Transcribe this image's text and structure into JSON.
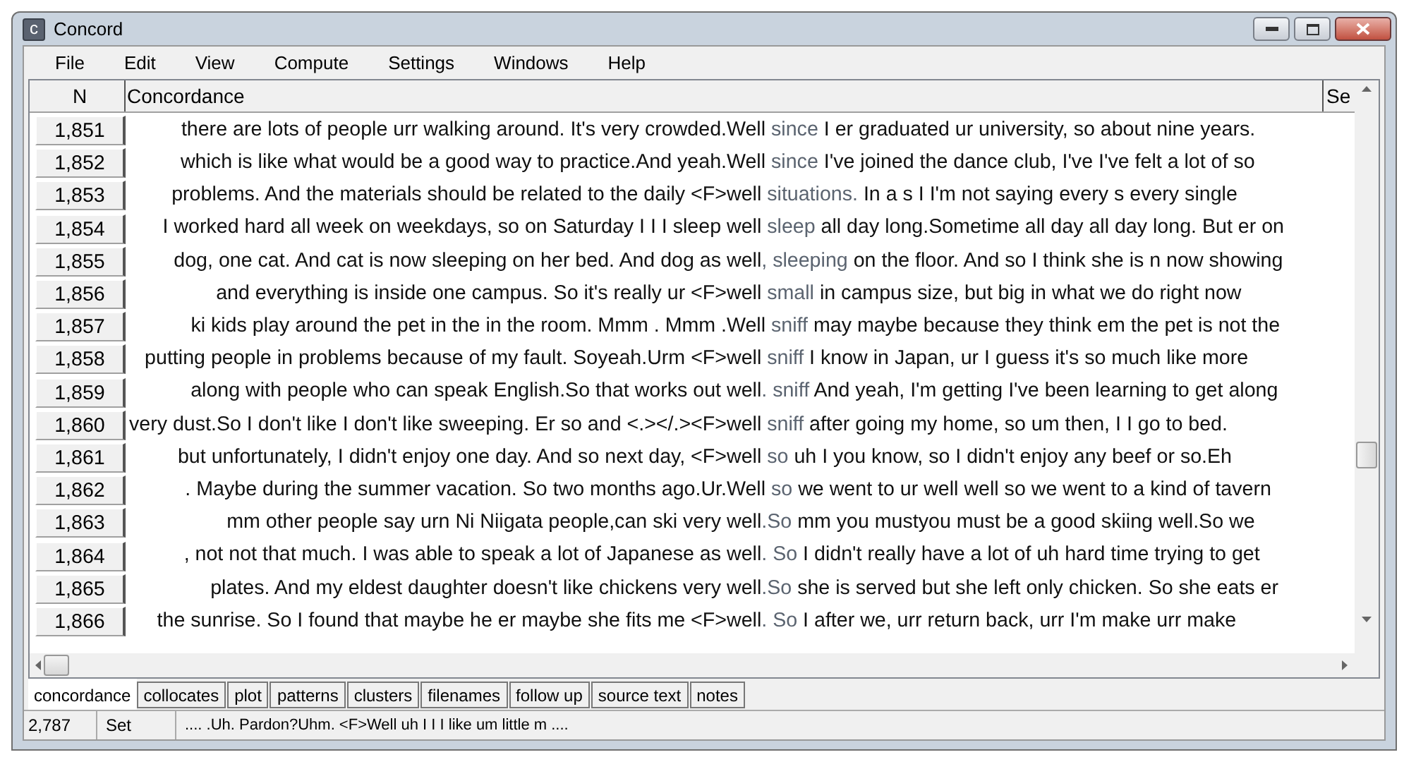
{
  "window": {
    "title": "Concord",
    "icon_letter": "c"
  },
  "menu": [
    "File",
    "Edit",
    "View",
    "Compute",
    "Settings",
    "Windows",
    "Help"
  ],
  "table": {
    "columns": [
      "N",
      "Concordance",
      "Se"
    ],
    "rows": [
      {
        "n": "1,851",
        "left": "there are lots of people urr walking around. It's very crowded.",
        "node": "Well",
        "collocate": " since",
        "right": " I er graduated ur university, so about nine years."
      },
      {
        "n": "1,852",
        "left": "which is like what would be a good way to practice.And yeah.",
        "node": "Well",
        "collocate": " since",
        "right": " I've joined the dance club, I've I've felt a lot of so"
      },
      {
        "n": "1,853",
        "left": "problems. And the materials should be related to the daily <F>",
        "node": "well",
        "collocate": " situations.",
        "right": " In a s I I'm not saying every s every single"
      },
      {
        "n": "1,854",
        "left": "I worked hard all week on weekdays, so on Saturday I I I sleep ",
        "node": "well",
        "collocate": " sleep",
        "right": " all day long.Sometime all day all day long. But er on"
      },
      {
        "n": "1,855",
        "left": "dog, one cat. And cat is now sleeping on her bed. And dog as ",
        "node": "well",
        "collocate": ", sleeping",
        "right": " on the floor. And so I think she is n now showing"
      },
      {
        "n": "1,856",
        "left": "and everything is inside one campus. So it's really ur <F>",
        "node": "well",
        "collocate": " small",
        "right": " in campus size, but big in what we do right now"
      },
      {
        "n": "1,857",
        "left": "ki kids play around the pet in the in the room. Mmm . Mmm .",
        "node": "Well",
        "collocate": " sniff",
        "right": " may maybe because they think em the pet is not the"
      },
      {
        "n": "1,858",
        "left": "putting people in problems because of my fault. Soyeah.Urm <F>",
        "node": "well",
        "collocate": " sniff",
        "right": " I know in Japan, ur I guess it's so much like more"
      },
      {
        "n": "1,859",
        "left": "along with people who can speak English.So that works out ",
        "node": "well",
        "collocate": ". sniff",
        "right": " And yeah, I'm getting I've been learning to get along"
      },
      {
        "n": "1,860",
        "left": "very dust.So I don't like I don't like sweeping. Er so and <.></.><F>",
        "node": "well",
        "collocate": " sniff",
        "right": " after going my home, so um then, I I go to bed."
      },
      {
        "n": "1,861",
        "left": "but unfortunately, I didn't enjoy one day. And so next day, <F>",
        "node": "well",
        "collocate": " so",
        "right": " uh I you know, so I didn't enjoy any beef or so.Eh"
      },
      {
        "n": "1,862",
        "left": ". Maybe during the summer vacation. So two months ago.Ur.",
        "node": "Well",
        "collocate": " so",
        "right": " we went to ur well well so we went to a kind of tavern"
      },
      {
        "n": "1,863",
        "left": "mm other people say urn Ni Niigata people,can ski very ",
        "node": "well",
        "collocate": ".So",
        "right": " mm you mustyou must be a good skiing well.So we"
      },
      {
        "n": "1,864",
        "left": ", not not that much. I was able to speak a lot of Japanese as ",
        "node": "well",
        "collocate": ". So",
        "right": " I didn't really have a lot of uh hard time trying to get"
      },
      {
        "n": "1,865",
        "left": "plates. And my eldest daughter doesn't like chickens very ",
        "node": "well",
        "collocate": ".So",
        "right": " she is served but she left only chicken. So she eats er"
      },
      {
        "n": "1,866",
        "left": "the sunrise. So I found that maybe he er maybe she fits me <F>",
        "node": "well",
        "collocate": ". So",
        "right": " I after we, urr return back, urr I'm make urr make"
      }
    ]
  },
  "tabs": [
    {
      "label": "concordance",
      "selected": true
    },
    {
      "label": "collocates",
      "selected": false
    },
    {
      "label": "plot",
      "selected": false
    },
    {
      "label": "patterns",
      "selected": false
    },
    {
      "label": "clusters",
      "selected": false
    },
    {
      "label": "filenames",
      "selected": false
    },
    {
      "label": "follow up",
      "selected": false
    },
    {
      "label": "source text",
      "selected": false
    },
    {
      "label": "notes",
      "selected": false
    }
  ],
  "status_bar": {
    "count": "2,787",
    "set": "Set",
    "context": ".... .Uh. Pardon?Uhm. <F>Well uh I I I like um little m ...."
  }
}
